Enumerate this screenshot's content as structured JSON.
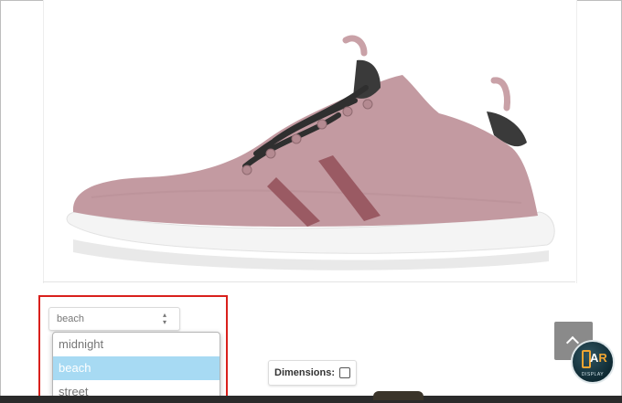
{
  "product": {
    "image_alt": "pink knit sneaker with dark laces",
    "color_select": {
      "value": "beach",
      "options": [
        {
          "label": "midnight",
          "selected": false
        },
        {
          "label": "beach",
          "selected": true
        },
        {
          "label": "street",
          "selected": false
        }
      ]
    }
  },
  "dimensions": {
    "label": "Dimensions:",
    "checked": false
  },
  "badge": {
    "main_a": "A",
    "main_r": "R",
    "sub": "DISPLAY"
  },
  "colors": {
    "highlight": "#d9201c",
    "selected_option": "#a7daf3",
    "badge_accent": "#f2a531"
  }
}
